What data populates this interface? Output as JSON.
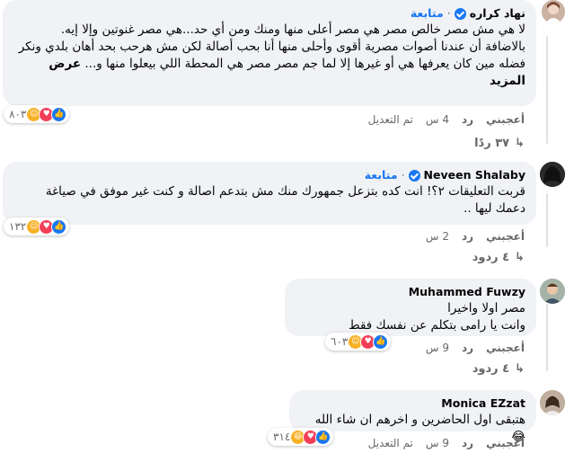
{
  "comments": [
    {
      "author": "نهاد كراره",
      "follow": "متابعة",
      "text": "لا هي مش مصر خالص مصر هي مصر أعلى منها ومنك ومن أي حد...هي مصر غنوتين وإلا إيه.\nبالاضافة أن عندنا أصوات مصرية أقوى وأحلى منها أنا بحب أصالة لكن مش هرحب بحد أهان بلدي ونكر فضله مين كان يعرفها هي أو غيرها إلا لما جم مصر مصر هي المحطة اللي بيعلوا منها و...",
      "see_more": "عرض المزيد",
      "like": "أعجبني",
      "reply": "رد",
      "time": "4 س",
      "edited": "تم التعديل",
      "reactions": "٨٠٣",
      "replies": "٣٧ ردًا"
    },
    {
      "author": "Neveen Shalaby",
      "follow": "متابعة",
      "text": "قربت التعليقات ٢؟! انت كده بتزعل جمهورك منك مش بتدعم اصالة و كنت غير موفق في صياغة دعمك ليها ..",
      "like": "أعجبني",
      "reply": "رد",
      "time": "2 س",
      "reactions": "١٣٢",
      "replies": "٤ ردود"
    },
    {
      "author": "Muhammed Fuwzy",
      "text": "مصر اولا واخيرا\nوانت يا رامى بتكلم عن نفسك فقط",
      "like": "أعجبني",
      "reply": "رد",
      "time": "9 س",
      "reactions": "٦٠٣",
      "replies": "٤ ردود"
    },
    {
      "author": "Monica EZzat",
      "text": "هتبقى اول الحاضرين و اخرهم ان شاء الله 😂",
      "like": "أعجبني",
      "reply": "رد",
      "time": "9 س",
      "edited": "تم التعديل",
      "reactions": "٣١٤"
    }
  ],
  "colors": {
    "bubble": "#f0f2f5",
    "accent": "#1877f2",
    "muted": "#65676b"
  }
}
